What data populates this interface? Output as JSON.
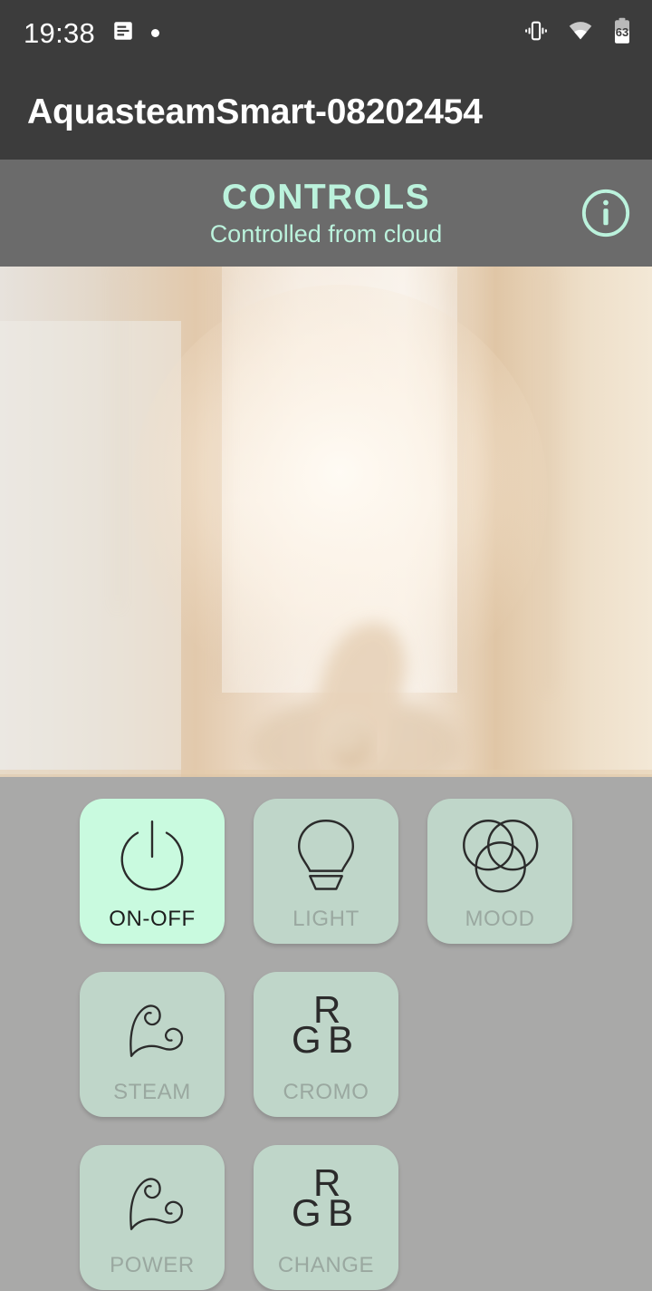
{
  "status_bar": {
    "time": "19:38",
    "battery_level": "63",
    "icons": [
      "notification-icon",
      "dot-icon",
      "vibrate-icon",
      "wifi-icon",
      "battery-icon"
    ],
    "background": "#3C3C3C",
    "foreground": "#FFFFFF"
  },
  "title_bar": {
    "app_title": "AquasteamSmart-08202454",
    "background": "#3C3C3C"
  },
  "controls_header": {
    "title": "CONTROLS",
    "subtitle": "Controlled from cloud",
    "accent_color": "#BBF2DC",
    "background": "#6B6B6B",
    "info_icon": "info-icon"
  },
  "hero": {
    "alt": "steam-room-photo",
    "description": "Person seated on marble bench in a steamy hammam room"
  },
  "theme": {
    "page_background": "#A9A9A8",
    "button_active_bg": "#C9FADF",
    "button_inactive_bg": "#BFD6C9",
    "label_active_color": "#1D1D1D",
    "label_inactive_color": "#9AA8A0",
    "icon_stroke": "#2B2B2B"
  },
  "controls": {
    "rows": [
      [
        {
          "label": "ON-OFF",
          "icon": "power-icon",
          "active": true
        },
        {
          "label": "LIGHT",
          "icon": "bulb-icon",
          "active": false
        },
        {
          "label": "MOOD",
          "icon": "venn-icon",
          "active": false
        }
      ],
      [
        {
          "label": "STEAM",
          "icon": "steam-icon",
          "active": false
        },
        {
          "label": "CROMO",
          "icon": "rgb-icon",
          "active": false
        }
      ],
      [
        {
          "label": "POWER",
          "icon": "steam-icon",
          "active": false
        },
        {
          "label": "CHANGE",
          "icon": "rgb-icon",
          "active": false
        }
      ]
    ]
  }
}
